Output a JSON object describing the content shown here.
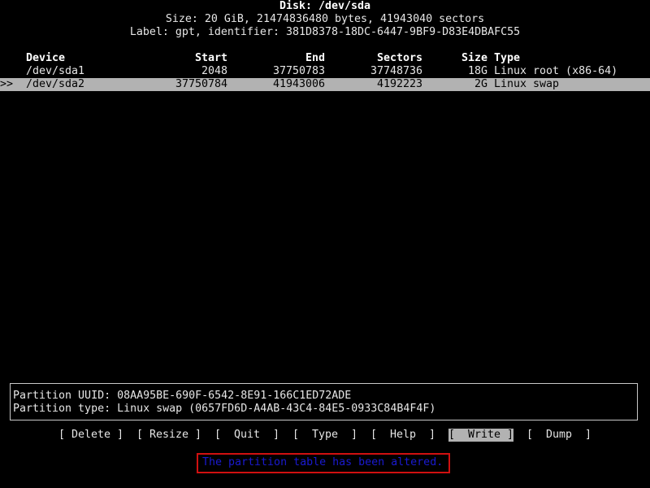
{
  "header": {
    "disk_title": "Disk: /dev/sda",
    "size_line": "Size: 20 GiB, 21474836480 bytes, 41943040 sectors",
    "label_line": "Label: gpt, identifier: 381D8378-18DC-6447-9BF9-D83E4DBAFC55"
  },
  "table": {
    "columns": {
      "device": "Device",
      "start": "Start",
      "end": "End",
      "sectors": "Sectors",
      "size": "Size",
      "type": "Type"
    },
    "rows": [
      {
        "pointer": "",
        "device": "/dev/sda1",
        "start": "2048",
        "end": "37750783",
        "sectors": "37748736",
        "size": "18G",
        "type": "Linux root (x86-64)",
        "selected": false
      },
      {
        "pointer": ">>",
        "device": "/dev/sda2",
        "start": "37750784",
        "end": "41943006",
        "sectors": "4192223",
        "size": "2G",
        "type": "Linux swap",
        "selected": true
      }
    ]
  },
  "info": {
    "uuid_line": "Partition UUID: 08AA95BE-690F-6542-8E91-166C1ED72ADE",
    "type_line": "Partition type: Linux swap (0657FD6D-A4AB-43C4-84E5-0933C84B4F4F)"
  },
  "menu": [
    {
      "label": "[ Delete ]",
      "active": false
    },
    {
      "label": "[ Resize ]",
      "active": false
    },
    {
      "label": "[  Quit  ]",
      "active": false
    },
    {
      "label": "[  Type  ]",
      "active": false
    },
    {
      "label": "[  Help  ]",
      "active": false
    },
    {
      "label": "[  Write ]",
      "active": true
    },
    {
      "label": "[  Dump  ]",
      "active": false
    }
  ],
  "status": {
    "message": "The partition table has been altered."
  },
  "colors": {
    "background": "#000000",
    "text": "#e6e6e6",
    "highlight": "#b2b2b2",
    "status_text": "#1a1ad0",
    "status_border": "#d01010"
  }
}
